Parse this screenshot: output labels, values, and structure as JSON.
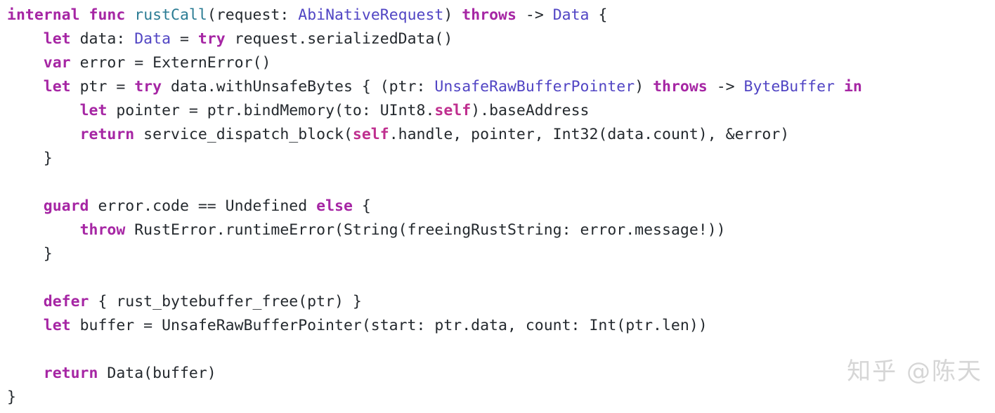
{
  "document": {
    "kind": "code-snippet",
    "language": "Swift",
    "background_color": "#ffffff",
    "colors": {
      "keyword": "#a626a4",
      "function_name": "#2b7c94",
      "type_name": "#5145c4",
      "plain_text": "#24292e",
      "self_keyword": "#bf2f8f",
      "watermark": "#d6d6d6"
    }
  },
  "code": {
    "lines": [
      {
        "n": 1,
        "text": "internal func rustCall(request: AbiNativeRequest) throws -> Data {",
        "tokens": [
          {
            "t": "internal",
            "c": "kw"
          },
          {
            "t": " ",
            "c": "pl"
          },
          {
            "t": "func",
            "c": "kw"
          },
          {
            "t": " ",
            "c": "pl"
          },
          {
            "t": "rustCall",
            "c": "fn"
          },
          {
            "t": "(request: ",
            "c": "pl"
          },
          {
            "t": "AbiNativeRequest",
            "c": "typ"
          },
          {
            "t": ") ",
            "c": "pl"
          },
          {
            "t": "throws",
            "c": "kw"
          },
          {
            "t": " -> ",
            "c": "pl"
          },
          {
            "t": "Data",
            "c": "typ"
          },
          {
            "t": " {",
            "c": "pl"
          }
        ]
      },
      {
        "n": 2,
        "text": "    let data: Data = try request.serializedData()",
        "tokens": [
          {
            "t": "    ",
            "c": "pl"
          },
          {
            "t": "let",
            "c": "kw"
          },
          {
            "t": " data: ",
            "c": "pl"
          },
          {
            "t": "Data",
            "c": "typ"
          },
          {
            "t": " = ",
            "c": "pl"
          },
          {
            "t": "try",
            "c": "kw"
          },
          {
            "t": " request.serializedData()",
            "c": "pl"
          }
        ]
      },
      {
        "n": 3,
        "text": "    var error = ExternError()",
        "tokens": [
          {
            "t": "    ",
            "c": "pl"
          },
          {
            "t": "var",
            "c": "kw"
          },
          {
            "t": " error = ExternError()",
            "c": "pl"
          }
        ]
      },
      {
        "n": 4,
        "text": "    let ptr = try data.withUnsafeBytes { (ptr: UnsafeRawBufferPointer) throws -> ByteBuffer in",
        "tokens": [
          {
            "t": "    ",
            "c": "pl"
          },
          {
            "t": "let",
            "c": "kw"
          },
          {
            "t": " ptr = ",
            "c": "pl"
          },
          {
            "t": "try",
            "c": "kw"
          },
          {
            "t": " data.withUnsafeBytes { (ptr: ",
            "c": "pl"
          },
          {
            "t": "UnsafeRawBufferPointer",
            "c": "typ"
          },
          {
            "t": ") ",
            "c": "pl"
          },
          {
            "t": "throws",
            "c": "kw"
          },
          {
            "t": " -> ",
            "c": "pl"
          },
          {
            "t": "ByteBuffer",
            "c": "typ"
          },
          {
            "t": " ",
            "c": "pl"
          },
          {
            "t": "in",
            "c": "kw"
          }
        ]
      },
      {
        "n": 5,
        "text": "        let pointer = ptr.bindMemory(to: UInt8.self).baseAddress",
        "tokens": [
          {
            "t": "        ",
            "c": "pl"
          },
          {
            "t": "let",
            "c": "kw"
          },
          {
            "t": " pointer = ptr.bindMemory(to: UInt8.",
            "c": "pl"
          },
          {
            "t": "self",
            "c": "slf"
          },
          {
            "t": ").baseAddress",
            "c": "pl"
          }
        ]
      },
      {
        "n": 6,
        "text": "        return service_dispatch_block(self.handle, pointer, Int32(data.count), &error)",
        "tokens": [
          {
            "t": "        ",
            "c": "pl"
          },
          {
            "t": "return",
            "c": "kw"
          },
          {
            "t": " service_dispatch_block(",
            "c": "pl"
          },
          {
            "t": "self",
            "c": "slf"
          },
          {
            "t": ".handle, pointer, Int32(data.count), &error)",
            "c": "pl"
          }
        ]
      },
      {
        "n": 7,
        "text": "    }",
        "tokens": [
          {
            "t": "    }",
            "c": "pl"
          }
        ]
      },
      {
        "n": 8,
        "text": "",
        "tokens": []
      },
      {
        "n": 9,
        "text": "    guard error.code == Undefined else {",
        "tokens": [
          {
            "t": "    ",
            "c": "pl"
          },
          {
            "t": "guard",
            "c": "kw"
          },
          {
            "t": " error.code == Undefined ",
            "c": "pl"
          },
          {
            "t": "else",
            "c": "kw"
          },
          {
            "t": " {",
            "c": "pl"
          }
        ]
      },
      {
        "n": 10,
        "text": "        throw RustError.runtimeError(String(freeingRustString: error.message!))",
        "tokens": [
          {
            "t": "        ",
            "c": "pl"
          },
          {
            "t": "throw",
            "c": "kw"
          },
          {
            "t": " RustError.runtimeError(String(freeingRustString: error.message!))",
            "c": "pl"
          }
        ]
      },
      {
        "n": 11,
        "text": "    }",
        "tokens": [
          {
            "t": "    }",
            "c": "pl"
          }
        ]
      },
      {
        "n": 12,
        "text": "",
        "tokens": []
      },
      {
        "n": 13,
        "text": "    defer { rust_bytebuffer_free(ptr) }",
        "tokens": [
          {
            "t": "    ",
            "c": "pl"
          },
          {
            "t": "defer",
            "c": "kw"
          },
          {
            "t": " { rust_bytebuffer_free(ptr) }",
            "c": "pl"
          }
        ]
      },
      {
        "n": 14,
        "text": "    let buffer = UnsafeRawBufferPointer(start: ptr.data, count: Int(ptr.len))",
        "tokens": [
          {
            "t": "    ",
            "c": "pl"
          },
          {
            "t": "let",
            "c": "kw"
          },
          {
            "t": " buffer = UnsafeRawBufferPointer(start: ptr.data, count: Int(ptr.len))",
            "c": "pl"
          }
        ]
      },
      {
        "n": 15,
        "text": "",
        "tokens": []
      },
      {
        "n": 16,
        "text": "    return Data(buffer)",
        "tokens": [
          {
            "t": "    ",
            "c": "pl"
          },
          {
            "t": "return",
            "c": "kw"
          },
          {
            "t": " Data(buffer)",
            "c": "pl"
          }
        ]
      },
      {
        "n": 17,
        "text": "}",
        "tokens": [
          {
            "t": "}",
            "c": "pl"
          }
        ]
      }
    ]
  },
  "watermark": {
    "text": "知乎 @陈天"
  }
}
